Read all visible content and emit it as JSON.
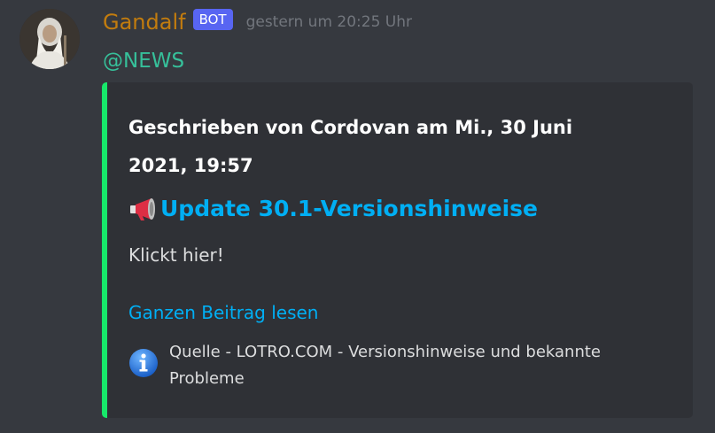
{
  "message": {
    "avatar_alt": "Gandalf avatar",
    "username": "Gandalf",
    "bot_tag": "BOT",
    "timestamp": "gestern um 20:25 Uhr",
    "mention": "@NEWS"
  },
  "embed": {
    "accent_color": "#17e86a",
    "author": "Geschrieben von Cordovan am Mi., 30 Juni 2021, 19:57",
    "title_icon": "megaphone-icon",
    "title": "Update 30.1-Versionshinweise",
    "description": "Klickt hier!",
    "link_text": "Ganzen Beitrag lesen",
    "footer_icon": "info-icon",
    "footer_text": "Quelle - LOTRO.COM - Versionshinweise und bekannte Probleme"
  },
  "colors": {
    "background": "#36393f",
    "embed_background": "#2f3136",
    "username": "#c27c0e",
    "bot_tag": "#5865f2",
    "mention": "#36c09a",
    "link": "#00aff4"
  }
}
